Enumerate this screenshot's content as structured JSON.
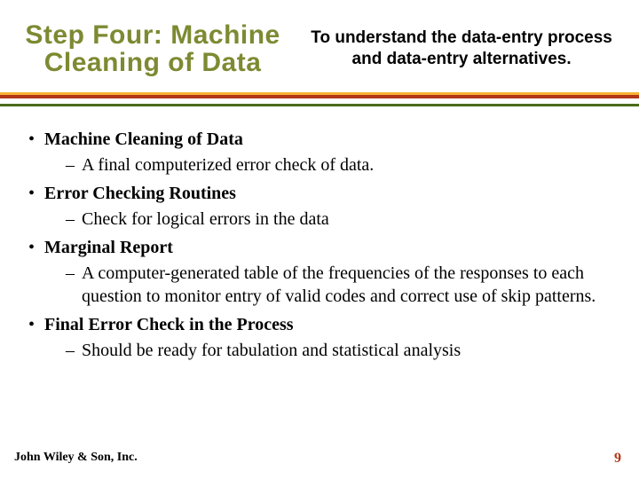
{
  "header": {
    "title_left": "Step Four:  Machine Cleaning of Data",
    "title_right": "To understand the data-entry process and data-entry alternatives."
  },
  "bullets": [
    {
      "label": "Machine Cleaning of Data",
      "sub": "A final computerized error check of data."
    },
    {
      "label": "Error Checking Routines",
      "sub": "Check for logical errors in the data"
    },
    {
      "label": "Marginal Report",
      "sub": "A computer-generated table of the frequencies of the responses to each question to monitor entry of valid codes and correct use of skip patterns."
    },
    {
      "label": "Final Error Check in the Process",
      "sub": "Should be ready for tabulation and statistical analysis"
    }
  ],
  "footer": {
    "publisher": "John Wiley & Son, Inc.",
    "page_number": "9"
  },
  "glyphs": {
    "bullet": "•",
    "dash": "–"
  }
}
